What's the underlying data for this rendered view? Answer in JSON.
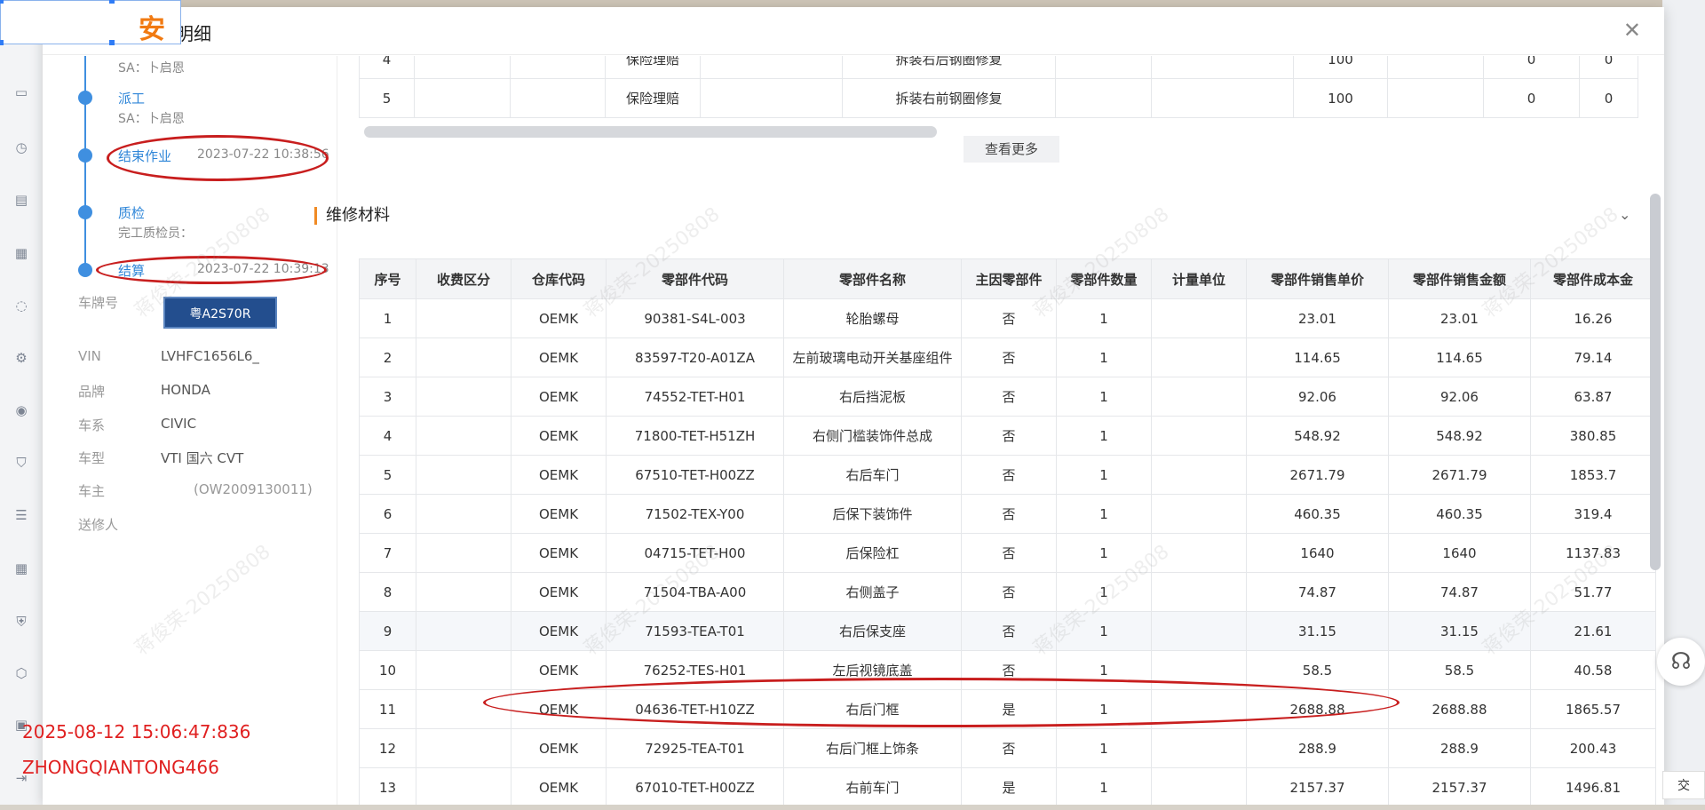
{
  "modal": {
    "title": "记录明细",
    "logo_text": "安"
  },
  "timeline": [
    {
      "label": "",
      "sub": "SA：卜启恩",
      "date": ""
    },
    {
      "label": "派工",
      "sub": "SA：卜启恩",
      "date": ""
    },
    {
      "label": "结束作业",
      "sub": "",
      "date": "2023-07-22 10:38:56"
    },
    {
      "label": "质检",
      "sub": "完工质检员：",
      "date": ""
    },
    {
      "label": "结算",
      "sub": "",
      "date": "2023-07-22 10:39:13"
    }
  ],
  "vehicle": {
    "plate_label": "车牌号",
    "plate": "粤A2S70R",
    "fields": [
      {
        "k": "VIN",
        "v": "LVHFC1656L6_"
      },
      {
        "k": "品牌",
        "v": "HONDA"
      },
      {
        "k": "车系",
        "v": "CIVIC"
      },
      {
        "k": "车型",
        "v": "VTI 国六 CVT"
      },
      {
        "k": "车主",
        "v": "(OW2009130011)"
      },
      {
        "k": "送修人",
        "v": ""
      }
    ]
  },
  "upper_table": {
    "rows": [
      [
        "4",
        "",
        "",
        "保险理赔",
        "",
        "拆装右后钢圈修复",
        "",
        "",
        "100",
        "",
        "0",
        "0"
      ],
      [
        "5",
        "",
        "",
        "保险理赔",
        "",
        "拆装右前钢圈修复",
        "",
        "",
        "100",
        "",
        "0",
        "0"
      ]
    ]
  },
  "view_more": "查看更多",
  "materials": {
    "title": "维修材料",
    "headers": [
      "序号",
      "收费区分",
      "仓库代码",
      "零部件代码",
      "零部件名称",
      "主因零部件",
      "零部件数量",
      "计量单位",
      "零部件销售单价",
      "零部件销售金额",
      "零部件成本金"
    ],
    "rows": [
      [
        "1",
        "",
        "OEMK",
        "90381-S4L-003",
        "轮胎螺母",
        "否",
        "1",
        "",
        "23.01",
        "23.01",
        "16.26"
      ],
      [
        "2",
        "",
        "OEMK",
        "83597-T20-A01ZA",
        "左前玻璃电动开关基座组件",
        "否",
        "1",
        "",
        "114.65",
        "114.65",
        "79.14"
      ],
      [
        "3",
        "",
        "OEMK",
        "74552-TET-H01",
        "右后挡泥板",
        "否",
        "1",
        "",
        "92.06",
        "92.06",
        "63.87"
      ],
      [
        "4",
        "",
        "OEMK",
        "71800-TET-H51ZH",
        "右侧门槛装饰件总成",
        "否",
        "1",
        "",
        "548.92",
        "548.92",
        "380.85"
      ],
      [
        "5",
        "",
        "OEMK",
        "67510-TET-H00ZZ",
        "右后车门",
        "否",
        "1",
        "",
        "2671.79",
        "2671.79",
        "1853.7"
      ],
      [
        "6",
        "",
        "OEMK",
        "71502-TEX-Y00",
        "后保下装饰件",
        "否",
        "1",
        "",
        "460.35",
        "460.35",
        "319.4"
      ],
      [
        "7",
        "",
        "OEMK",
        "04715-TET-H00",
        "后保险杠",
        "否",
        "1",
        "",
        "1640",
        "1640",
        "1137.83"
      ],
      [
        "8",
        "",
        "OEMK",
        "71504-TBA-A00",
        "右侧盖子",
        "否",
        "1",
        "",
        "74.87",
        "74.87",
        "51.77"
      ],
      [
        "9",
        "",
        "OEMK",
        "71593-TEA-T01",
        "右后保支座",
        "否",
        "1",
        "",
        "31.15",
        "31.15",
        "21.61"
      ],
      [
        "10",
        "",
        "OEMK",
        "76252-TES-H01",
        "左后视镜底盖",
        "否",
        "1",
        "",
        "58.5",
        "58.5",
        "40.58"
      ],
      [
        "11",
        "",
        "OEMK",
        "04636-TET-H10ZZ",
        "右后门框",
        "是",
        "1",
        "",
        "2688.88",
        "2688.88",
        "1865.57"
      ],
      [
        "12",
        "",
        "OEMK",
        "72925-TEA-T01",
        "右后门框上饰条",
        "否",
        "1",
        "",
        "288.9",
        "288.9",
        "200.43"
      ],
      [
        "13",
        "",
        "OEMK",
        "67010-TET-H00ZZ",
        "右前车门",
        "是",
        "1",
        "",
        "2157.37",
        "2157.37",
        "1496.81"
      ]
    ]
  },
  "watermark": "蒋俊荣-20250808",
  "stamp": {
    "datetime": "2025-08-12 15:06:47:836",
    "user": "ZHONGQIANTONG466"
  },
  "submit_label": "交"
}
